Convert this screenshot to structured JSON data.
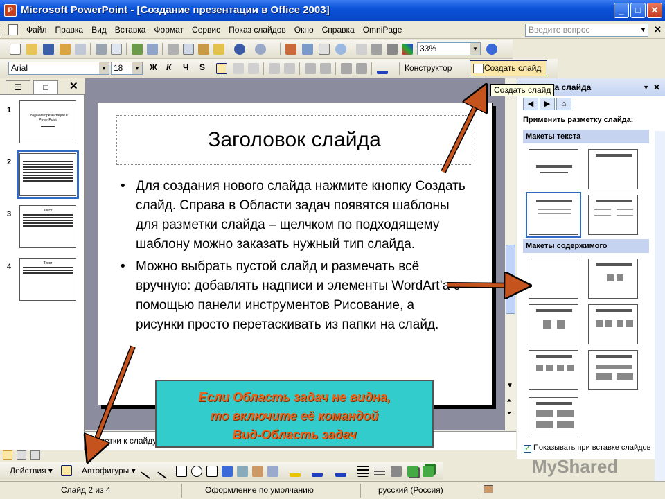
{
  "window": {
    "title": "Microsoft PowerPoint - [Создание презентации в Office 2003]"
  },
  "menu": {
    "items": [
      "Файл",
      "Правка",
      "Вид",
      "Вставка",
      "Формат",
      "Сервис",
      "Показ слайдов",
      "Окно",
      "Справка",
      "OmniPage"
    ],
    "help_placeholder": "Введите вопрос"
  },
  "toolbar": {
    "zoom": "33%",
    "font_name": "Arial",
    "font_size": "18",
    "bold_label": "Ж",
    "italic_label": "К",
    "underline_label": "Ч",
    "shadow_label": "S",
    "designer_label": "Конструктор",
    "new_slide_label": "Создать слайд",
    "tooltip": "Создать слайд"
  },
  "slides_panel": {
    "slides": [
      {
        "number": "1",
        "title": "Создание презентации в PowerPoint"
      },
      {
        "number": "2",
        "title": ""
      },
      {
        "number": "3",
        "title": "Текст"
      },
      {
        "number": "4",
        "title": "Текст"
      }
    ]
  },
  "slide": {
    "title": "Заголовок слайда",
    "bullets": [
      "Для создания нового слайда нажмите кнопку Создать слайд. Справа в Области задач появятся шаблоны для разметки слайда – щелчком по подходящему шаблону можно заказать нужный тип слайда.",
      "Можно выбрать пустой слайд и размечать всё вручную: добавлять надписи и элементы WordArt’а с помощью панели инструментов Рисование, а рисунки просто перетаскивать из папки на слайд."
    ]
  },
  "notes": {
    "placeholder": "Заметки к слайду"
  },
  "task_pane": {
    "title": "Разметка слайда",
    "apply_label": "Применить разметку слайда:",
    "section_text": "Макеты текста",
    "section_content": "Макеты содержимого",
    "show_on_insert": "Показывать при вставке слайдов"
  },
  "drawing": {
    "actions_label": "Действия",
    "autoshapes_label": "Автофигуры"
  },
  "status": {
    "slide_pos": "Слайд 2 из 4",
    "design": "Оформление по умолчанию",
    "language": "русский (Россия)"
  },
  "callout": {
    "line1": "Если Область задач не видна,",
    "line2": "то включите её командой",
    "line3": "Вид-Область задач"
  },
  "watermark": "MyShared"
}
